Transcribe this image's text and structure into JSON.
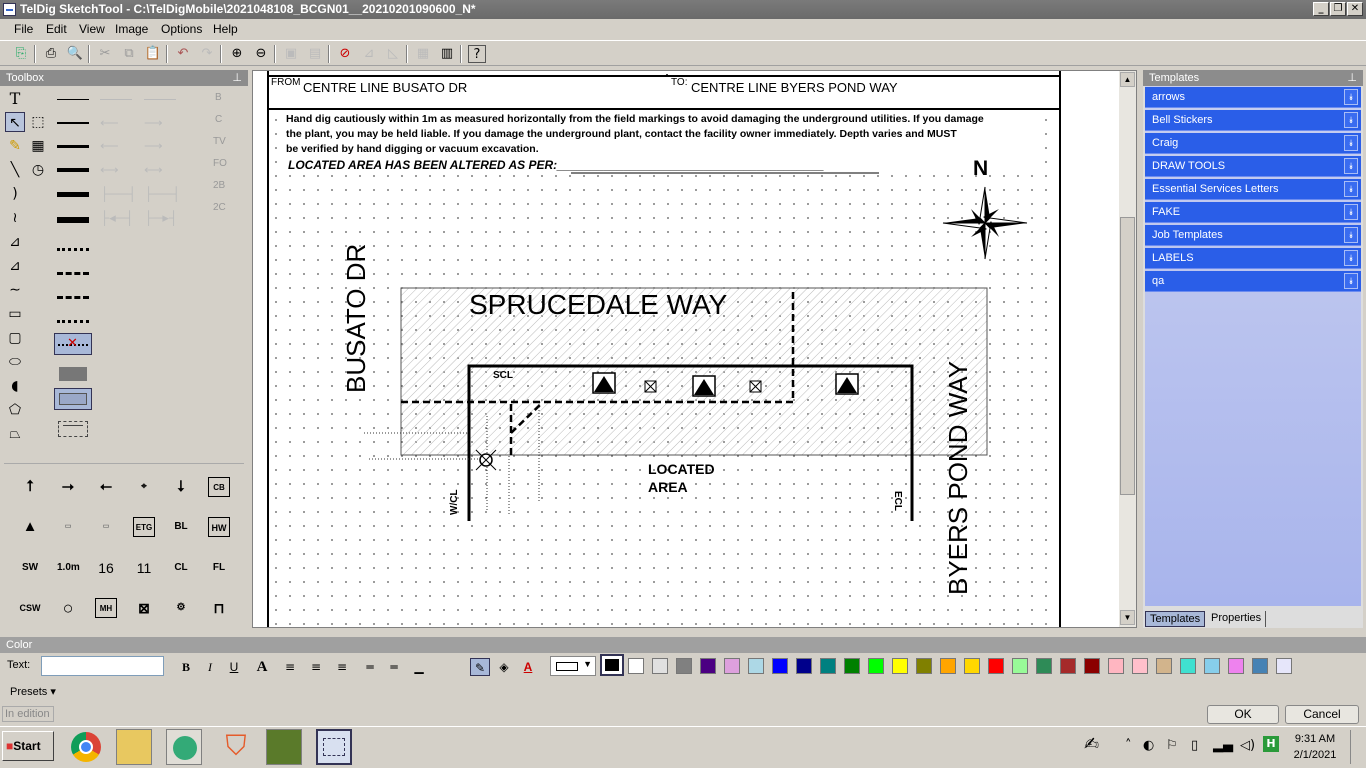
{
  "window": {
    "title": "TelDig SketchTool - C:\\TelDigMobile\\2021048108_BCGN01__20210201090600_N*"
  },
  "menu": [
    "File",
    "Edit",
    "View",
    "Image",
    "Options",
    "Help"
  ],
  "toolbox": {
    "title": "Toolbox",
    "line_type_labels": [
      "B",
      "C",
      "TV",
      "FO",
      "2B",
      "2C"
    ],
    "stamps": [
      "CB",
      "ETG",
      "BL",
      "HW",
      "SW",
      "1.0m",
      "16",
      "11",
      "CL",
      "FL",
      "CSW",
      "MH"
    ]
  },
  "sketch": {
    "from_label": "FROM",
    "from_value": "CENTRE LINE BUSATO DR",
    "to_label": "TO:",
    "to_value": "CENTRE LINE BYERS POND WAY",
    "warning_line1": "Hand dig cautiously within 1m as measured horizontally from the field markings to avoid damaging the underground utilities. If you damage",
    "warning_line2": "the plant, you may be held liable. If you damage the underground plant, contact the facility owner immediately. Depth varies and MUST",
    "warning_line3": "be verified by hand digging or vacuum excavation.",
    "altered": "LOCATED AREA HAS BEEN ALTERED AS PER:________________________________________",
    "north": "N",
    "street_busato": "BUSATO DR",
    "street_sprucedale": "SPRUCEDALE WAY",
    "street_byers": "BYERS POND WAY",
    "scl": "SCL",
    "wcl": "W/CL",
    "ecl": "ECL",
    "located_area_1": "LOCATED",
    "located_area_2": "AREA"
  },
  "templates": {
    "title": "Templates",
    "items": [
      "arrows",
      "Bell Stickers",
      "Craig",
      "DRAW TOOLS",
      "Essential Services Letters",
      "FAKE",
      "Job Templates",
      "LABELS",
      "qa"
    ],
    "tab_templates": "Templates",
    "tab_properties": "Properties"
  },
  "color_panel": {
    "title": "Color",
    "text_label": "Text:",
    "text_value": "",
    "presets_label": "Presets",
    "swatches": [
      "#ffffff",
      "#e0e0e0",
      "#808080",
      "#4b0082",
      "#dda0dd",
      "#add8e6",
      "#0000ff",
      "#00008b",
      "#008080",
      "#008000",
      "#00ff00",
      "#ffff00",
      "#808000",
      "#ffa500",
      "#ffd700",
      "#ff0000",
      "#98fb98",
      "#2e8b57",
      "#a52a2a",
      "#8b0000",
      "#ffb6c1",
      "#ffc0cb",
      "#d2b48c",
      "#40e0d0",
      "#87ceeb",
      "#ee82ee",
      "#4682b4",
      "#e6e6fa"
    ]
  },
  "status": {
    "mode": "In edition",
    "ok": "OK",
    "cancel": "Cancel"
  },
  "taskbar": {
    "start": "Start",
    "time": "9:31 AM",
    "date": "2/1/2021"
  }
}
